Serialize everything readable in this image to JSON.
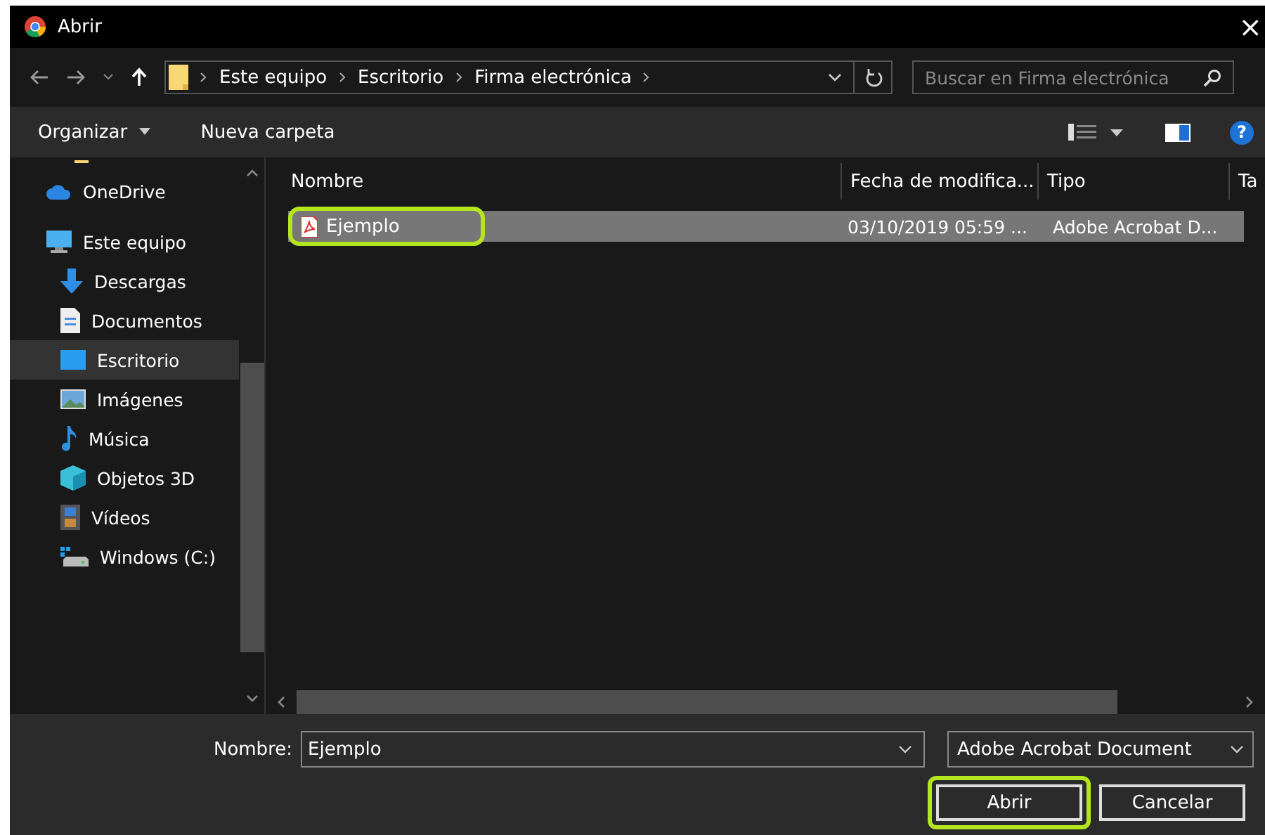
{
  "window": {
    "title": "Abrir",
    "close": "×"
  },
  "address": {
    "path": [
      {
        "label": "Este equipo"
      },
      {
        "label": "Escritorio"
      },
      {
        "label": "Firma electrónica"
      }
    ]
  },
  "search": {
    "placeholder": "Buscar en Firma electrónica"
  },
  "toolbar": {
    "organize": "Organizar",
    "new_folder": "Nueva carpeta",
    "help": "?"
  },
  "sidebar": {
    "items": [
      {
        "label": "OneDrive",
        "kind": "cloud",
        "selected": false
      },
      {
        "label": "Este equipo",
        "kind": "pc",
        "selected": false,
        "children": [
          {
            "label": "Descargas",
            "kind": "download",
            "selected": false
          },
          {
            "label": "Documentos",
            "kind": "doc",
            "selected": false
          },
          {
            "label": "Escritorio",
            "kind": "desktop",
            "selected": true
          },
          {
            "label": "Imágenes",
            "kind": "image",
            "selected": false
          },
          {
            "label": "Música",
            "kind": "music",
            "selected": false
          },
          {
            "label": "Objetos 3D",
            "kind": "cube",
            "selected": false
          },
          {
            "label": "Vídeos",
            "kind": "video",
            "selected": false
          },
          {
            "label": "Windows (C:)",
            "kind": "drive",
            "selected": false
          }
        ]
      }
    ]
  },
  "table": {
    "columns": [
      "Nombre",
      "Fecha de modifica...",
      "Tipo",
      "Ta"
    ],
    "rows": [
      {
        "name": "Ejemplo",
        "date": "03/10/2019 05:59 ...",
        "type": "Adobe Acrobat D...",
        "selected": true,
        "highlighted": true
      }
    ]
  },
  "footer": {
    "name_label": "Nombre:",
    "name_value": "Ejemplo",
    "filter": "Adobe Acrobat Document",
    "buttons": [
      {
        "label": "Abrir",
        "highlighted": true
      },
      {
        "label": "Cancelar",
        "highlighted": false
      }
    ]
  }
}
